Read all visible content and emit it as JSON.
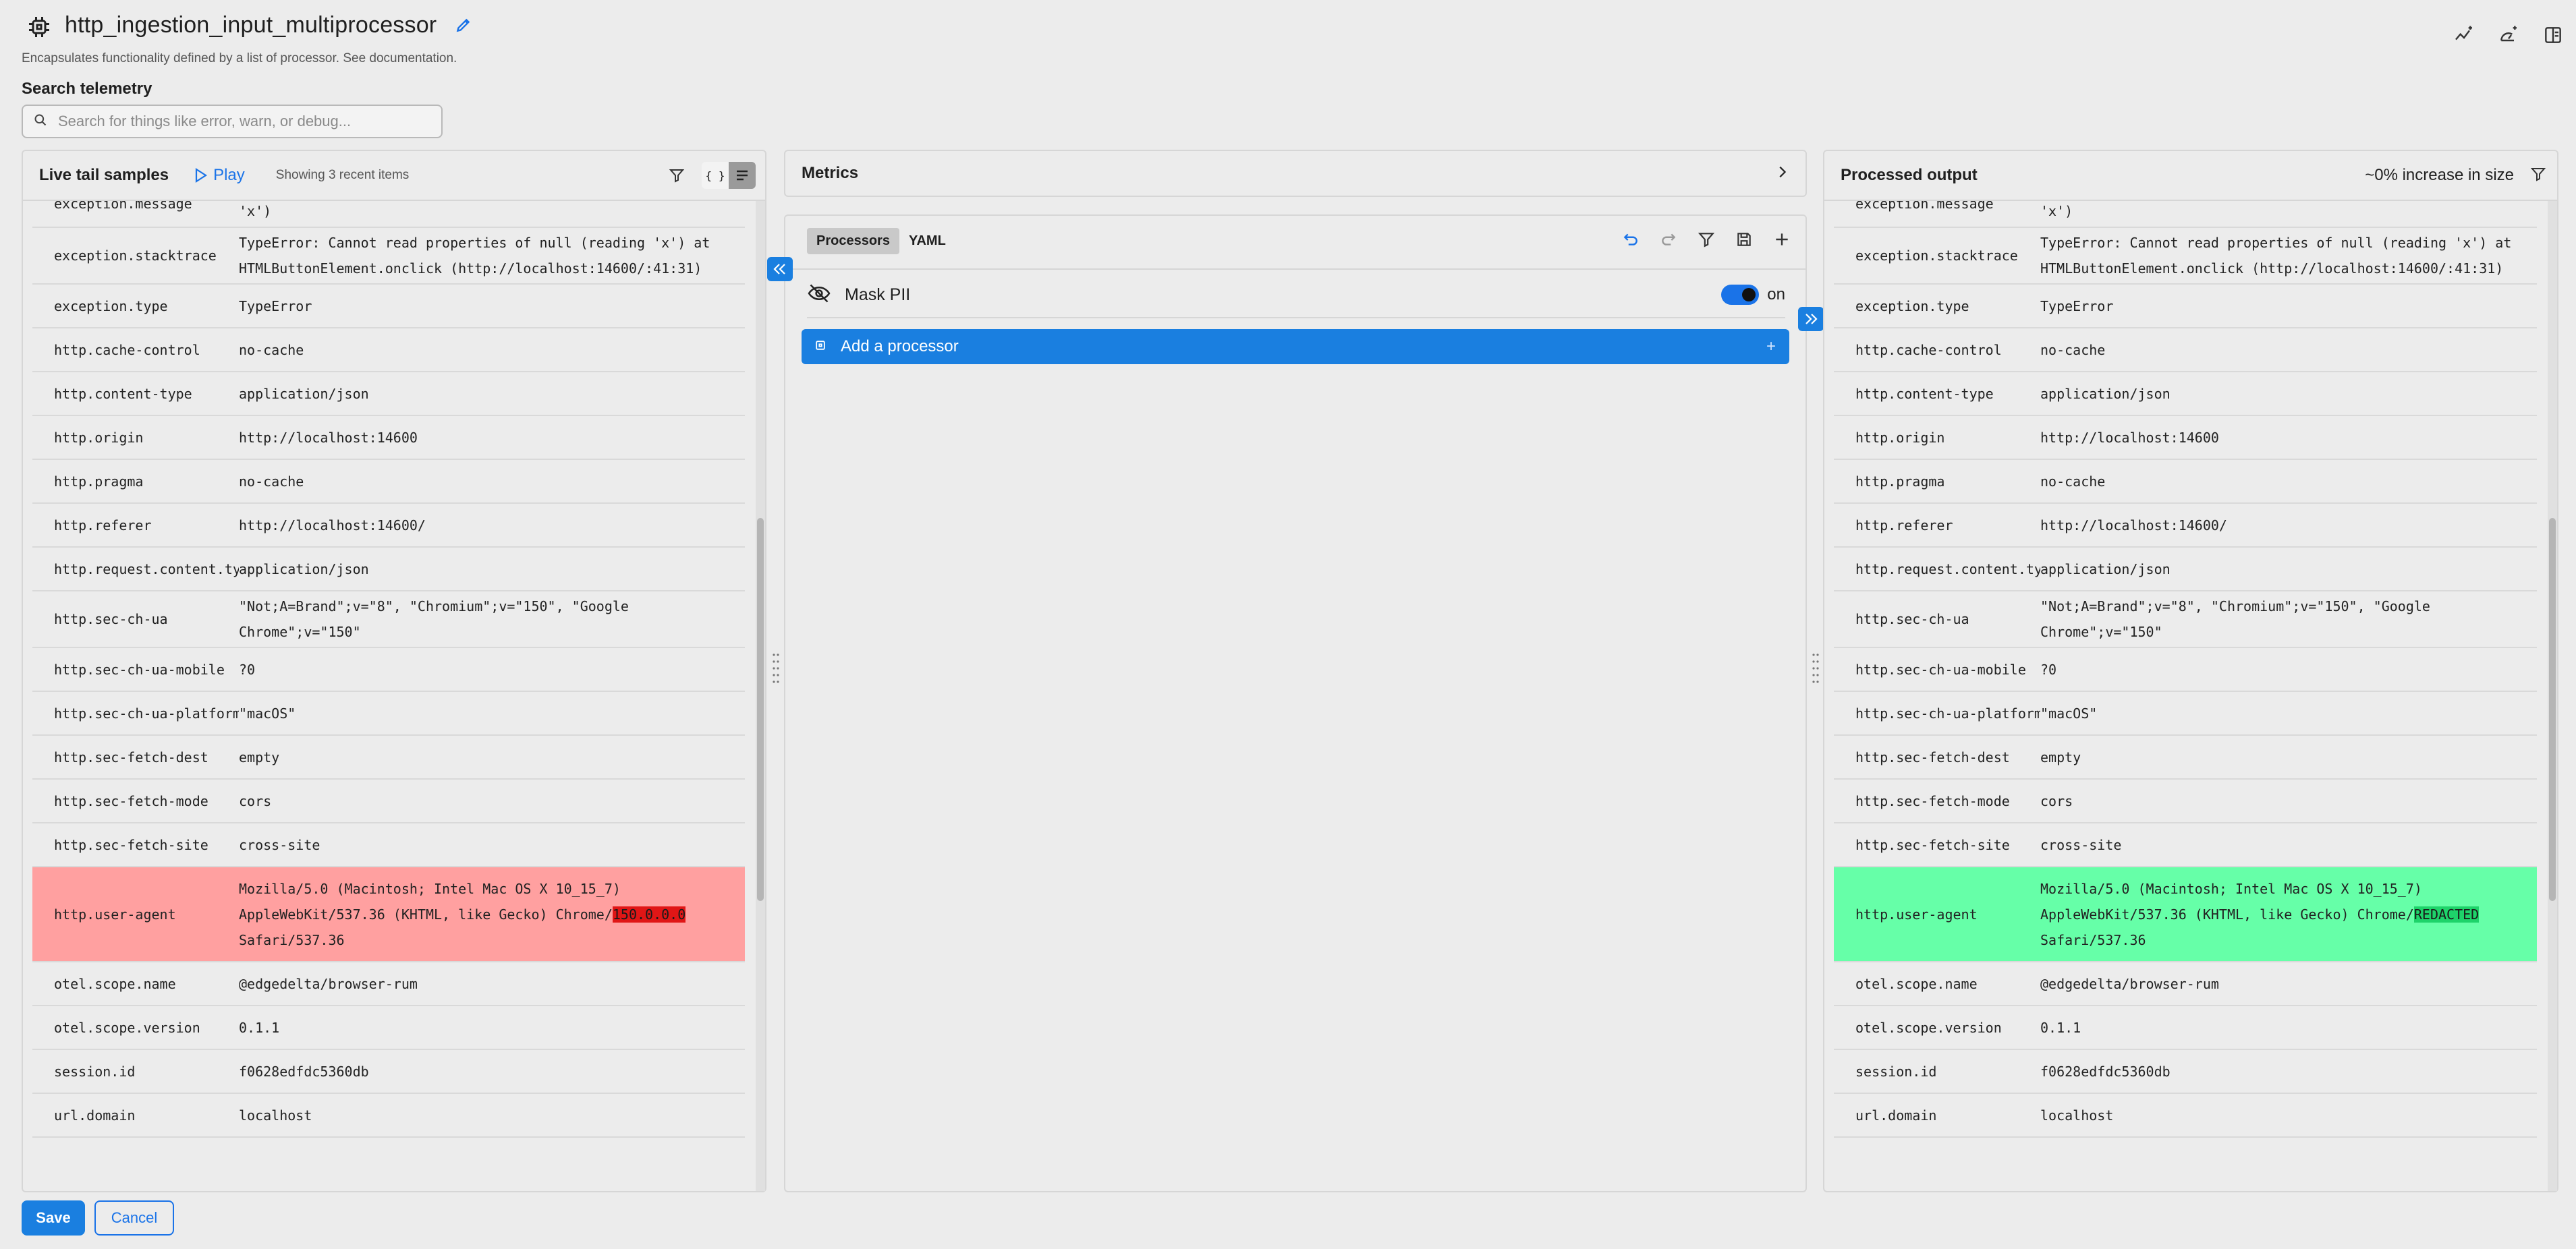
{
  "header": {
    "title": "http_ingestion_input_multiprocessor",
    "subtitle": "Encapsulates functionality defined by a list of processor. See documentation."
  },
  "search": {
    "label": "Search telemetry",
    "placeholder": "Search for things like error, warn, or debug..."
  },
  "left_panel": {
    "title": "Live tail samples",
    "play_label": "Play",
    "showing": "Showing 3 recent items",
    "rows": [
      {
        "key": "exception.message",
        "value": "'x')"
      },
      {
        "key": "exception.stacktrace",
        "value": "TypeError: Cannot read properties of null (reading 'x') at HTMLButtonElement.onclick (http://localhost:14600/:41:31)"
      },
      {
        "key": "exception.type",
        "value": "TypeError"
      },
      {
        "key": "http.cache-control",
        "value": "no-cache"
      },
      {
        "key": "http.content-type",
        "value": "application/json"
      },
      {
        "key": "http.origin",
        "value": "http://localhost:14600"
      },
      {
        "key": "http.pragma",
        "value": "no-cache"
      },
      {
        "key": "http.referer",
        "value": "http://localhost:14600/"
      },
      {
        "key": "http.request.content.ty…",
        "value": "application/json"
      },
      {
        "key": "http.sec-ch-ua",
        "value": "\"Not;A=Brand\";v=\"8\", \"Chromium\";v=\"150\", \"Google Chrome\";v=\"150\""
      },
      {
        "key": "http.sec-ch-ua-mobile",
        "value": "?0"
      },
      {
        "key": "http.sec-ch-ua-platform",
        "value": "\"macOS\""
      },
      {
        "key": "http.sec-fetch-dest",
        "value": "empty"
      },
      {
        "key": "http.sec-fetch-mode",
        "value": "cors"
      },
      {
        "key": "http.sec-fetch-site",
        "value": "cross-site"
      },
      {
        "key": "http.user-agent",
        "value_pre": "Mozilla/5.0 (Macintosh; Intel Mac OS X 10_15_7) AppleWebKit/537.36 (KHTML, like Gecko) Chrome/",
        "value_mark": "150.0.0.0",
        "value_post": " Safari/537.36",
        "diff": "removed"
      },
      {
        "key": "otel.scope.name",
        "value": "@edgedelta/browser-rum"
      },
      {
        "key": "otel.scope.version",
        "value": "0.1.1"
      },
      {
        "key": "session.id",
        "value": "f0628edfdc5360db"
      },
      {
        "key": "url.domain",
        "value": "localhost"
      }
    ]
  },
  "metrics": {
    "title": "Metrics"
  },
  "processors": {
    "tabs": [
      "Processors",
      "YAML"
    ],
    "active_tab": "Processors",
    "items": [
      {
        "name": "Mask PII",
        "enabled_label": "on"
      }
    ],
    "add_label": "Add a processor"
  },
  "right_panel": {
    "title": "Processed output",
    "size_change": "~0% increase in size",
    "rows": [
      {
        "key": "exception.message",
        "value": "'x')"
      },
      {
        "key": "exception.stacktrace",
        "value": "TypeError: Cannot read properties of null (reading 'x') at HTMLButtonElement.onclick (http://localhost:14600/:41:31)"
      },
      {
        "key": "exception.type",
        "value": "TypeError"
      },
      {
        "key": "http.cache-control",
        "value": "no-cache"
      },
      {
        "key": "http.content-type",
        "value": "application/json"
      },
      {
        "key": "http.origin",
        "value": "http://localhost:14600"
      },
      {
        "key": "http.pragma",
        "value": "no-cache"
      },
      {
        "key": "http.referer",
        "value": "http://localhost:14600/"
      },
      {
        "key": "http.request.content.ty…",
        "value": "application/json"
      },
      {
        "key": "http.sec-ch-ua",
        "value": "\"Not;A=Brand\";v=\"8\", \"Chromium\";v=\"150\", \"Google Chrome\";v=\"150\""
      },
      {
        "key": "http.sec-ch-ua-mobile",
        "value": "?0"
      },
      {
        "key": "http.sec-ch-ua-platform",
        "value": "\"macOS\""
      },
      {
        "key": "http.sec-fetch-dest",
        "value": "empty"
      },
      {
        "key": "http.sec-fetch-mode",
        "value": "cors"
      },
      {
        "key": "http.sec-fetch-site",
        "value": "cross-site"
      },
      {
        "key": "http.user-agent",
        "value_pre": "Mozilla/5.0 (Macintosh; Intel Mac OS X 10_15_7) AppleWebKit/537.36 (KHTML, like Gecko) Chrome/",
        "value_mark": "REDACTED",
        "value_post": " Safari/537.36",
        "diff": "added"
      },
      {
        "key": "otel.scope.name",
        "value": "@edgedelta/browser-rum"
      },
      {
        "key": "otel.scope.version",
        "value": "0.1.1"
      },
      {
        "key": "session.id",
        "value": "f0628edfdc5360db"
      },
      {
        "key": "url.domain",
        "value": "localhost"
      }
    ]
  },
  "footer": {
    "save_label": "Save",
    "cancel_label": "Cancel"
  },
  "colors": {
    "accent": "#1a7fe0",
    "removed_row": "#ffa0a0",
    "added_row": "#66ffa8"
  }
}
